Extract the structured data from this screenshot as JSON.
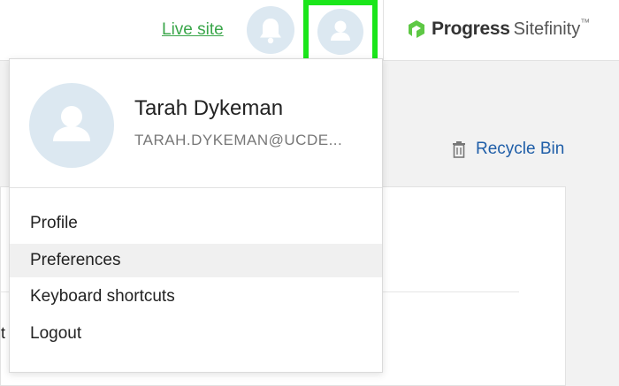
{
  "header": {
    "live_site_label": "Live site",
    "brand_name": "Progress",
    "brand_product": "Sitefinity",
    "brand_mark": "™"
  },
  "page": {
    "recycle_bin_label": "Recycle Bin",
    "stray_text": "t"
  },
  "user_menu": {
    "name": "Tarah Dykeman",
    "email": "TARAH.DYKEMAN@UCDE...",
    "items": [
      {
        "label": "Profile"
      },
      {
        "label": "Preferences"
      },
      {
        "label": "Keyboard shortcuts"
      },
      {
        "label": "Logout"
      }
    ],
    "highlighted_item": "Preferences"
  },
  "colors": {
    "accent_green": "#3aa64a",
    "highlight_frame": "#1ae61a",
    "avatar_bg": "#dce8f1",
    "link_blue": "#1f5ea8"
  },
  "icons": {
    "notifications": "bell-icon",
    "user": "user-icon",
    "recycle": "trash-icon",
    "brand": "progress-logo-icon"
  }
}
